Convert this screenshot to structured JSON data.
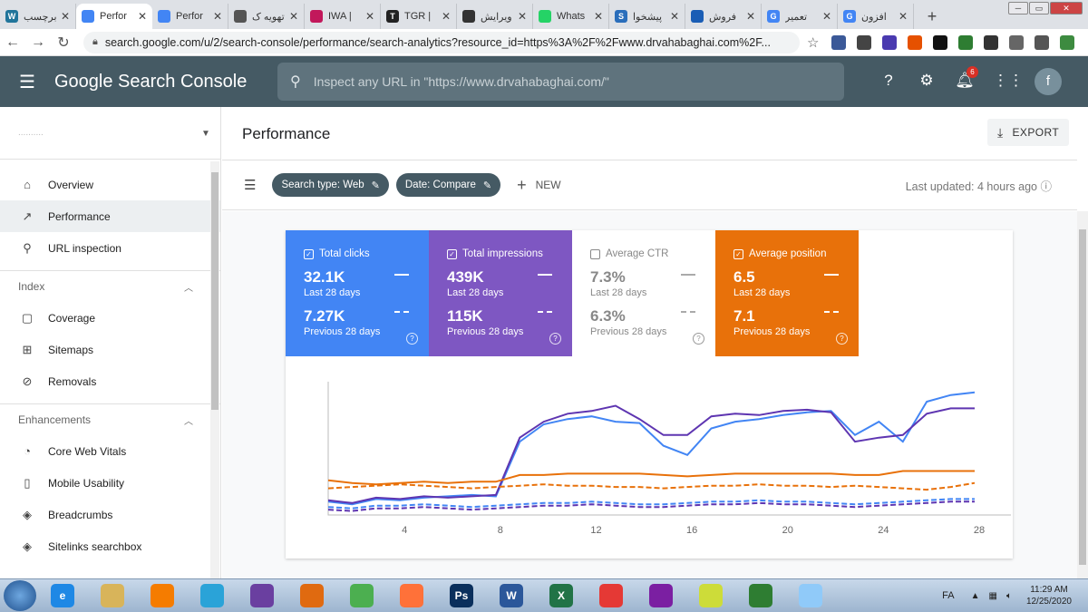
{
  "browser": {
    "tabs": [
      {
        "title": "برچسب",
        "fav_color": "#21759b",
        "fav_text": "W",
        "active": false
      },
      {
        "title": "Perfor",
        "fav_color": "#4285f4",
        "fav_text": "",
        "active": true
      },
      {
        "title": "Perfor",
        "fav_color": "#4285f4",
        "fav_text": "",
        "active": false
      },
      {
        "title": "تهویه ک",
        "fav_color": "#555555",
        "fav_text": "",
        "active": false
      },
      {
        "title": "IWA |",
        "fav_color": "#c2185b",
        "fav_text": "",
        "active": false
      },
      {
        "title": "TGR |",
        "fav_color": "#222222",
        "fav_text": "T",
        "active": false
      },
      {
        "title": "ویرایش",
        "fav_color": "#333333",
        "fav_text": "",
        "active": false
      },
      {
        "title": "Whats",
        "fav_color": "#25d366",
        "fav_text": "",
        "active": false
      },
      {
        "title": "پیشخوا",
        "fav_color": "#2a6ebb",
        "fav_text": "S",
        "active": false
      },
      {
        "title": "فروش",
        "fav_color": "#1a5db5",
        "fav_text": "",
        "active": false
      },
      {
        "title": "تعمیر",
        "fav_color": "#4285f4",
        "fav_text": "G",
        "active": false
      },
      {
        "title": "افزون",
        "fav_color": "#4285f4",
        "fav_text": "G",
        "active": false
      }
    ],
    "url": "search.google.com/u/2/search-console/performance/search-analytics?resource_id=https%3A%2F%2Fwww.drvahabaghai.com%2F...",
    "extension_colors": [
      "#3b5998",
      "#444444",
      "#4a3ab0",
      "#e65100",
      "#111111",
      "#2e7d32",
      "#333333",
      "#666666",
      "#555555",
      "#3d8b40"
    ]
  },
  "header": {
    "product_name": "Google Search Console",
    "search_placeholder": "Inspect any URL in \"https://www.drvahabaghai.com/\"",
    "notification_count": "6",
    "avatar_letter": "f"
  },
  "sidebar": {
    "property_placeholder": "..........",
    "items_top": [
      {
        "label": "Overview",
        "icon": "home-icon",
        "glyph": "⌂",
        "active": false
      },
      {
        "label": "Performance",
        "icon": "trending-up-icon",
        "glyph": "↗",
        "active": true
      },
      {
        "label": "URL inspection",
        "icon": "search-icon",
        "glyph": "⚲",
        "active": false
      }
    ],
    "index_section": "Index",
    "items_index": [
      {
        "label": "Coverage",
        "icon": "coverage-icon",
        "glyph": "▢"
      },
      {
        "label": "Sitemaps",
        "icon": "sitemap-icon",
        "glyph": "⊞"
      },
      {
        "label": "Removals",
        "icon": "removals-icon",
        "glyph": "⊘"
      }
    ],
    "enhancements_section": "Enhancements",
    "items_enh": [
      {
        "label": "Core Web Vitals",
        "icon": "speed-icon",
        "glyph": "◔"
      },
      {
        "label": "Mobile Usability",
        "icon": "phone-icon",
        "glyph": "▯"
      },
      {
        "label": "Breadcrumbs",
        "icon": "layers-icon",
        "glyph": "◈"
      },
      {
        "label": "Sitelinks searchbox",
        "icon": "layers-icon",
        "glyph": "◈"
      }
    ]
  },
  "main": {
    "title": "Performance",
    "export_label": "EXPORT",
    "chips": [
      {
        "label": "Search type: Web"
      },
      {
        "label": "Date: Compare"
      }
    ],
    "new_label": "NEW",
    "last_updated": "Last updated: 4 hours ago",
    "metrics": [
      {
        "label": "Total clicks",
        "value": "32.1K",
        "period": "Last 28 days",
        "prev_value": "7.27K",
        "prev_period": "Previous 28 days",
        "color": "#4285f4",
        "checked": true
      },
      {
        "label": "Total impressions",
        "value": "439K",
        "period": "Last 28 days",
        "prev_value": "115K",
        "prev_period": "Previous 28 days",
        "color": "#7e57c2",
        "checked": true
      },
      {
        "label": "Average CTR",
        "value": "7.3%",
        "period": "Last 28 days",
        "prev_value": "6.3%",
        "prev_period": "Previous 28 days",
        "color": "#ffffff",
        "checked": false
      },
      {
        "label": "Average position",
        "value": "6.5",
        "period": "Last 28 days",
        "prev_value": "7.1",
        "prev_period": "Previous 28 days",
        "color": "#e8710a",
        "checked": true
      }
    ]
  },
  "chart_data": {
    "type": "line",
    "x": [
      1,
      2,
      3,
      4,
      5,
      6,
      7,
      8,
      9,
      10,
      11,
      12,
      13,
      14,
      15,
      16,
      17,
      18,
      19,
      20,
      21,
      22,
      23,
      24,
      25,
      26,
      27,
      28
    ],
    "x_ticks": [
      "4",
      "8",
      "12",
      "16",
      "20",
      "24",
      "28"
    ],
    "ylim": [
      0,
      100
    ],
    "series": [
      {
        "color": "#4285f4",
        "style": "solid",
        "values": [
          10,
          8,
          12,
          11,
          13,
          14,
          15,
          14,
          55,
          68,
          72,
          74,
          70,
          69,
          52,
          45,
          65,
          70,
          72,
          75,
          77,
          78,
          60,
          70,
          55,
          85,
          90,
          92
        ]
      },
      {
        "color": "#5e35b1",
        "style": "solid",
        "values": [
          11,
          9,
          13,
          12,
          14,
          13,
          14,
          15,
          58,
          70,
          76,
          78,
          82,
          72,
          60,
          60,
          74,
          76,
          75,
          78,
          79,
          77,
          55,
          58,
          60,
          76,
          80,
          80
        ]
      },
      {
        "color": "#e8710a",
        "style": "solid",
        "values": [
          26,
          24,
          23,
          24,
          25,
          24,
          25,
          25,
          30,
          30,
          31,
          31,
          31,
          31,
          30,
          29,
          30,
          31,
          31,
          31,
          31,
          31,
          30,
          30,
          33,
          33,
          33,
          33
        ]
      },
      {
        "color": "#e8710a",
        "style": "dashed",
        "values": [
          20,
          21,
          22,
          23,
          22,
          21,
          20,
          21,
          22,
          23,
          22,
          22,
          21,
          21,
          20,
          21,
          22,
          22,
          23,
          22,
          22,
          21,
          22,
          21,
          20,
          19,
          21,
          24
        ]
      },
      {
        "color": "#4285f4",
        "style": "dashed",
        "values": [
          6,
          5,
          7,
          7,
          8,
          7,
          6,
          7,
          8,
          9,
          9,
          10,
          9,
          8,
          8,
          9,
          10,
          10,
          11,
          10,
          10,
          9,
          8,
          9,
          10,
          11,
          12,
          12
        ]
      },
      {
        "color": "#5e35b1",
        "style": "dashed",
        "values": [
          4,
          3,
          5,
          5,
          6,
          5,
          4,
          5,
          6,
          7,
          7,
          8,
          7,
          6,
          6,
          7,
          8,
          8,
          9,
          8,
          8,
          7,
          6,
          7,
          8,
          9,
          10,
          10
        ]
      }
    ]
  },
  "taskbar": {
    "apps": [
      {
        "icon": "ie-icon",
        "color": "#1e88e5",
        "text": "e"
      },
      {
        "icon": "explorer-icon",
        "color": "#d8b45a",
        "text": ""
      },
      {
        "icon": "media-player-icon",
        "color": "#f57c00",
        "text": ""
      },
      {
        "icon": "telegram-icon",
        "color": "#2aa3d8",
        "text": ""
      },
      {
        "icon": "visual-studio-icon",
        "color": "#6a3fa0",
        "text": ""
      },
      {
        "icon": "fl-studio-icon",
        "color": "#e06a10",
        "text": ""
      },
      {
        "icon": "chrome-icon",
        "color": "#4caf50",
        "text": ""
      },
      {
        "icon": "firefox-icon",
        "color": "#ff7139",
        "text": ""
      },
      {
        "icon": "photoshop-icon",
        "color": "#0a2f5c",
        "text": "Ps"
      },
      {
        "icon": "word-icon",
        "color": "#2b579a",
        "text": "W"
      },
      {
        "icon": "excel-icon",
        "color": "#217346",
        "text": "X"
      },
      {
        "icon": "xmind-icon",
        "color": "#e53935",
        "text": ""
      },
      {
        "icon": "podcast-icon",
        "color": "#7b1fa2",
        "text": ""
      },
      {
        "icon": "notes-icon",
        "color": "#cddc39",
        "text": ""
      },
      {
        "icon": "soccer-icon",
        "color": "#2e7d32",
        "text": ""
      },
      {
        "icon": "paint-icon",
        "color": "#90caf9",
        "text": ""
      }
    ],
    "lang": "FA",
    "time": "11:29 AM",
    "date": "12/25/2020"
  }
}
